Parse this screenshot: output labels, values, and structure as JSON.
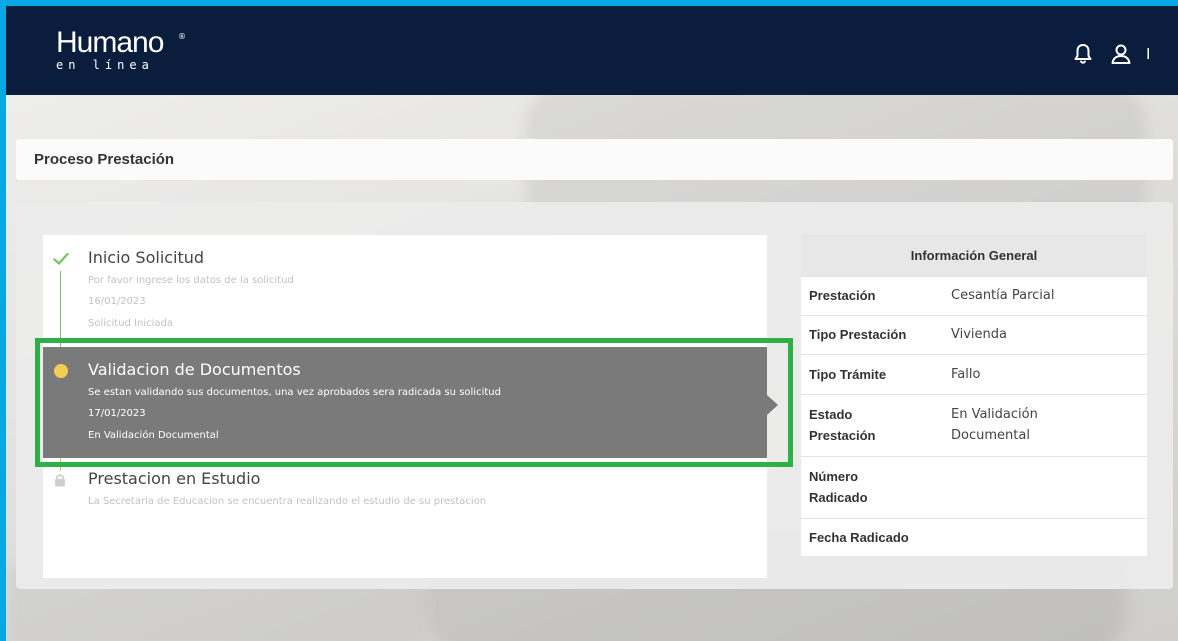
{
  "header": {
    "logo_main": "Humano",
    "logo_reg": "®",
    "logo_sub": "en línea",
    "user_initial": "I",
    "icons": [
      "bell-icon",
      "user-icon"
    ]
  },
  "page": {
    "title": "Proceso Prestación"
  },
  "timeline": {
    "steps": [
      {
        "title": "Inicio Solicitud",
        "description": "Por favor ingrese los datos de la solicitud",
        "date": "16/01/2023",
        "status": "Solicitud Iniciada",
        "state": "completed",
        "icon": "check-icon"
      },
      {
        "title": "Validacion de Documentos",
        "description": "Se estan validando sus documentos, una vez aprobados sera radicada su solicitud",
        "date": "17/01/2023",
        "status": "En Validación Documental",
        "state": "active",
        "icon": "dot-icon"
      },
      {
        "title": "Prestacion en Estudio",
        "description": "La Secretaria de Educacion se encuentra realizando el estudio de su prestacion",
        "state": "locked",
        "icon": "lock-icon"
      }
    ]
  },
  "info": {
    "title": "Información General",
    "rows": [
      {
        "label": "Prestación",
        "value": "Cesantía Parcial"
      },
      {
        "label": "Tipo Prestación",
        "value": "Vivienda"
      },
      {
        "label": "Tipo Trámite",
        "value": "Fallo"
      },
      {
        "label_line1": "Estado",
        "label_line2": "Prestación",
        "value_line1": "En Validación",
        "value_line2": "Documental"
      },
      {
        "label_line1": "Número",
        "label_line2": "Radicado",
        "value": ""
      },
      {
        "label": "Fecha Radicado",
        "value": ""
      }
    ]
  },
  "colors": {
    "frame": "#08a7e6",
    "topbar": "#0b1d3c",
    "completed": "#7cc36b",
    "active_dot": "#f2cf52",
    "active_bg": "#7a7a7a",
    "highlight": "#2fb046"
  }
}
